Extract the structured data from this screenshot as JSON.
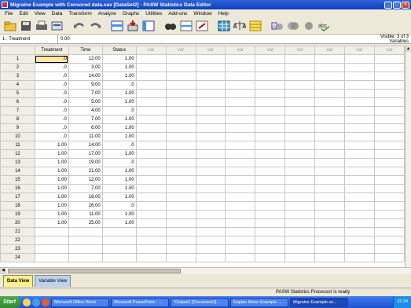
{
  "window": {
    "title": "Migraine Example with Censored data.sav [DataSet2] - PASW Statistics Data Editor"
  },
  "menu": [
    "File",
    "Edit",
    "View",
    "Data",
    "Transform",
    "Analyze",
    "Graphs",
    "Utilities",
    "Add-ons",
    "Window",
    "Help"
  ],
  "toolbar_icons": [
    "open-icon",
    "save-icon",
    "print-icon",
    "recall-dialog-icon",
    "undo-icon",
    "redo-icon",
    "goto-case-icon",
    "goto-variable-icon",
    "variables-icon",
    "find-icon",
    "insert-cases-icon",
    "insert-variable-icon",
    "split-file-icon",
    "weight-cases-icon",
    "select-cases-icon",
    "value-labels-icon",
    "use-sets-icon",
    "show-all-variables-icon",
    "spell-check-icon"
  ],
  "cell_editor": {
    "ref": "1 : Treatment",
    "value": "0.00",
    "visible": "Visible: 3 of 3 Variables"
  },
  "grid": {
    "columns": [
      "Treatment",
      "Time",
      "Status",
      "var",
      "var",
      "var",
      "var",
      "var",
      "var",
      "var",
      "var",
      "var"
    ],
    "rows": [
      [
        "1",
        ".0",
        "12.00",
        "1.00"
      ],
      [
        "2",
        ".0",
        "3.00",
        "1.00"
      ],
      [
        "3",
        ".0",
        "14.00",
        "1.00"
      ],
      [
        "4",
        ".0",
        "9.00",
        ".0"
      ],
      [
        "5",
        ".0",
        "7.00",
        "1.00"
      ],
      [
        "6",
        ".0",
        "5.00",
        "1.00"
      ],
      [
        "7",
        ".0",
        "4.00",
        ".0"
      ],
      [
        "8",
        ".0",
        "7.00",
        "1.00"
      ],
      [
        "9",
        ".0",
        "6.00",
        "1.00"
      ],
      [
        "10",
        ".0",
        "11.00",
        "1.00"
      ],
      [
        "11",
        "1.00",
        "14.00",
        ".0"
      ],
      [
        "12",
        "1.00",
        "17.00",
        "1.00"
      ],
      [
        "13",
        "1.00",
        "19.00",
        ".0"
      ],
      [
        "14",
        "1.00",
        "21.00",
        "1.00"
      ],
      [
        "15",
        "1.00",
        "12.00",
        "1.00"
      ],
      [
        "16",
        "1.00",
        "7.00",
        "1.00"
      ],
      [
        "17",
        "1.00",
        "18.00",
        "1.00"
      ],
      [
        "18",
        "1.00",
        "26.00",
        ".0"
      ],
      [
        "19",
        "1.00",
        "11.00",
        "1.00"
      ],
      [
        "20",
        "1.00",
        "25.00",
        "1.00"
      ],
      [
        "21",
        "",
        "",
        ""
      ],
      [
        "22",
        "",
        "",
        ""
      ],
      [
        "23",
        "",
        "",
        ""
      ],
      [
        "24",
        "",
        "",
        ""
      ]
    ]
  },
  "tabs": {
    "data_view": "Data View",
    "variable_view": "Variable View"
  },
  "status": "PASW Statistics Processor is ready",
  "taskbar": {
    "start": "Start",
    "tasks": [
      "Microsoft Office Word",
      "Microsoft PowerPoint - ...",
      "*Output1 [Document1]...",
      "Kaplan Meier Example ...",
      "Migraine Example wi..."
    ],
    "clock": "22:34"
  },
  "colors": {
    "title_bar": "#0a3fc2",
    "active_tab": "#fbf089",
    "selected_cell": "#fde9a7"
  }
}
